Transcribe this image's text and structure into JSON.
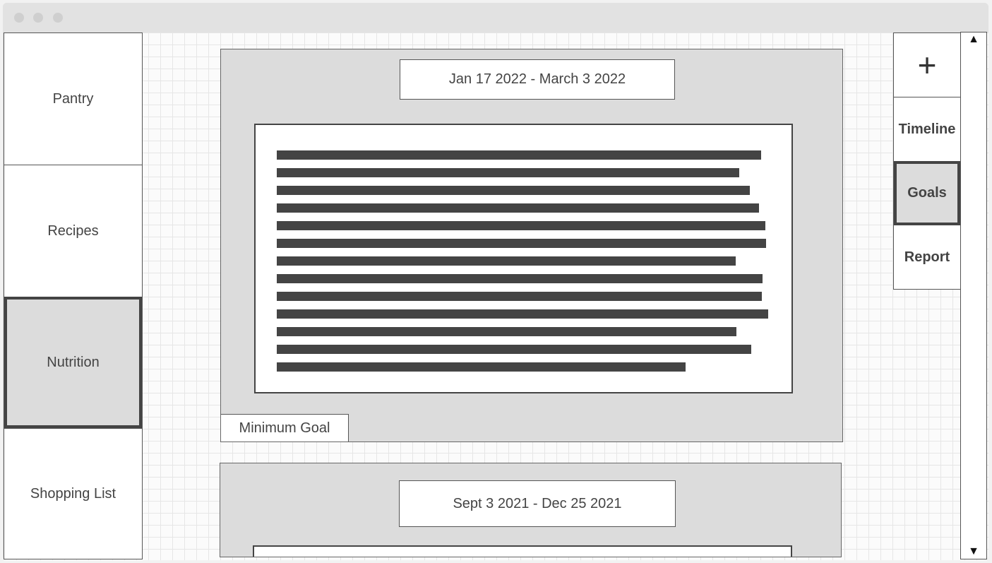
{
  "sidebar": {
    "items": [
      {
        "label": "Pantry",
        "active": false
      },
      {
        "label": "Recipes",
        "active": false
      },
      {
        "label": "Nutrition",
        "active": true
      },
      {
        "label": "Shopping List",
        "active": false
      }
    ]
  },
  "right_nav": {
    "add_icon": "plus-icon",
    "add_glyph": "+",
    "items": [
      {
        "label": "Timeline",
        "active": false
      },
      {
        "label": "Goals",
        "active": true
      },
      {
        "label": "Report",
        "active": false
      }
    ]
  },
  "cards": [
    {
      "date_range": "Jan 17 2022 - March 3 2022",
      "goal_label": "Minimum Goal",
      "text_placeholder_lines": 13
    },
    {
      "date_range": "Sept 3 2021 - Dec 25 2021"
    }
  ],
  "scrollbar": {
    "up_glyph": "▲",
    "down_glyph": "▼"
  },
  "colors": {
    "panel": "#dcdcdc",
    "dark": "#444444",
    "border": "#555555"
  }
}
